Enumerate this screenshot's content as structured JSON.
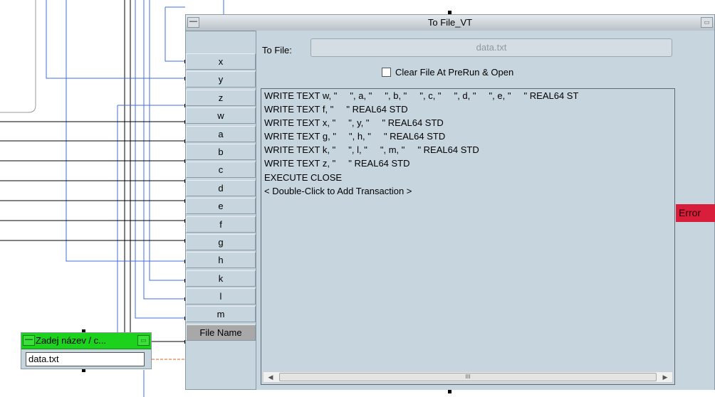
{
  "window": {
    "title": "To File_VT",
    "to_file_label": "To File:",
    "file_value": "data.txt",
    "clear_label": "Clear File At PreRun & Open",
    "clear_checked": false
  },
  "pins": [
    "x",
    "y",
    "z",
    "w",
    "a",
    "b",
    "c",
    "d",
    "e",
    "f",
    "g",
    "h",
    "k",
    "l",
    "m",
    "File Name"
  ],
  "transactions": [
    "WRITE TEXT w, \"     \", a, \"     \", b, \"     \", c, \"     \", d, \"     \", e, \"     \" REAL64 ST",
    "WRITE TEXT f, \"     \" REAL64 STD",
    "WRITE TEXT x, \"     \", y, \"     \" REAL64 STD",
    "WRITE TEXT g, \"     \", h, \"     \" REAL64 STD",
    "WRITE TEXT k, \"     \", l, \"     \", m, \"     \" REAL64 STD",
    "WRITE TEXT z, \"     \" REAL64 STD",
    "EXECUTE CLOSE",
    "< Double-Click to Add Transaction >"
  ],
  "output": {
    "error_label": "Error"
  },
  "scrollbar": {
    "thumb_grip": "III",
    "left_arrow": "◀",
    "right_arrow": "▶"
  },
  "input_object": {
    "title": "Zadej název / c...",
    "value": "data.txt",
    "accent": "#1dd21d"
  },
  "icons": {
    "minimize": "minimize-icon",
    "maximize": "maximize-icon"
  },
  "colors": {
    "error": "#d81e3a",
    "wire_blue": "#3f6fd8",
    "object_bg": "#c7d6de",
    "wire_orange": "#e0602a"
  }
}
